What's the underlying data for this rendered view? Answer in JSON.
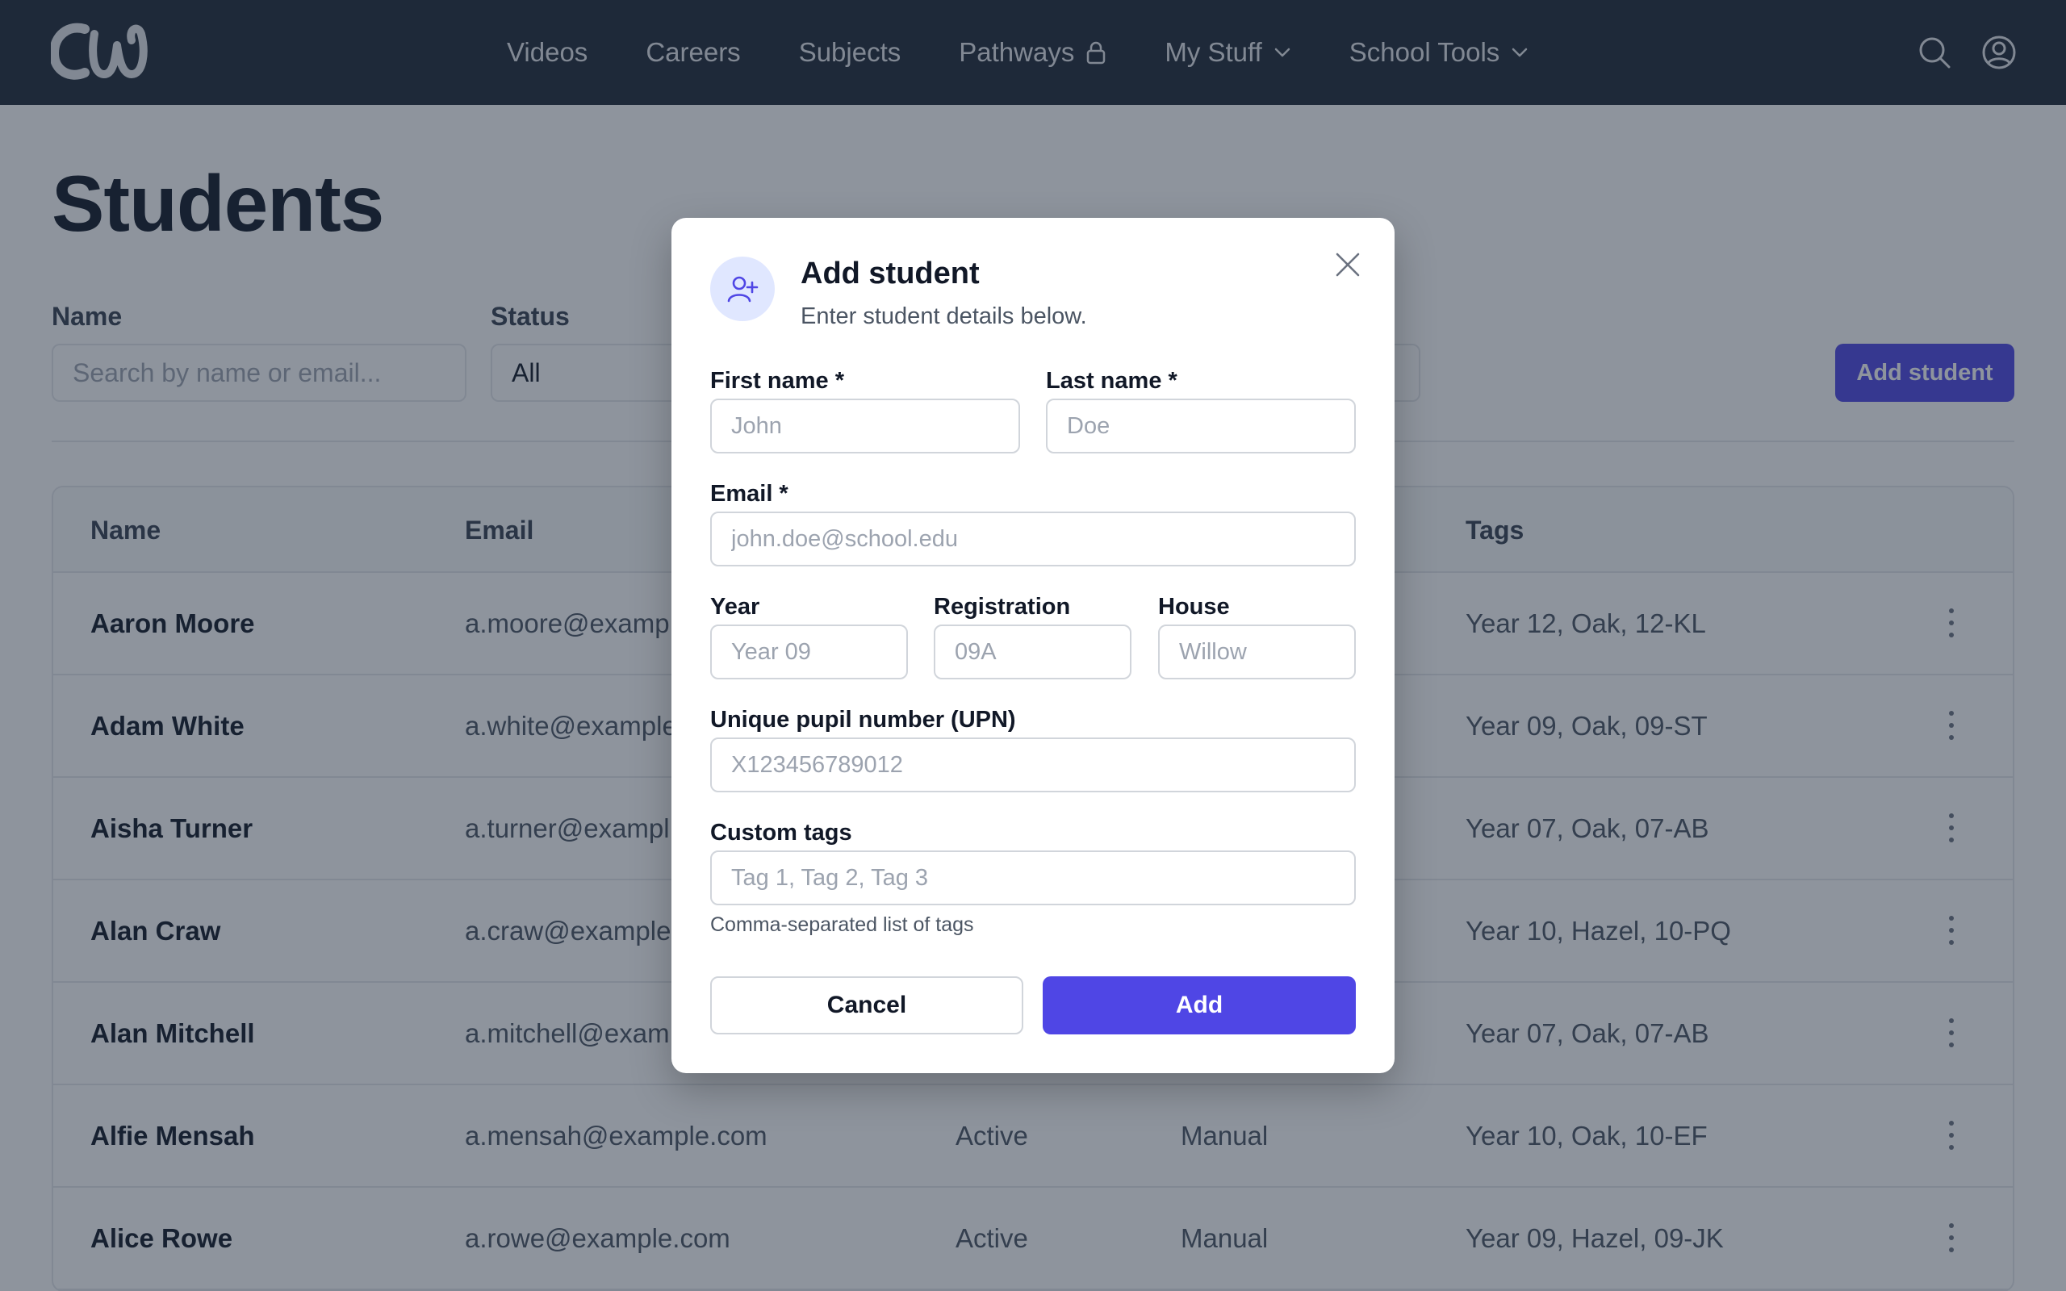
{
  "nav": {
    "links": [
      {
        "label": "Videos"
      },
      {
        "label": "Careers"
      },
      {
        "label": "Subjects"
      },
      {
        "label": "Pathways",
        "icon": "lock-icon"
      },
      {
        "label": "My Stuff",
        "icon": "chevron-down-icon"
      },
      {
        "label": "School Tools",
        "icon": "chevron-down-icon"
      }
    ],
    "icons": [
      "search-icon",
      "user-circle-icon"
    ]
  },
  "page": {
    "title": "Students",
    "filters": {
      "name_label": "Name",
      "name_placeholder": "Search by name or email...",
      "status_label": "Status",
      "status_value": "All"
    },
    "add_student_label": "Add student"
  },
  "table": {
    "headers": [
      "Name",
      "Email",
      "Tags"
    ],
    "rows": [
      {
        "name": "Aaron Moore",
        "email": "a.moore@examp",
        "tags": "Year 12, Oak, 12-KL"
      },
      {
        "name": "Adam White",
        "email": "a.white@example",
        "tags": "Year 09, Oak, 09-ST"
      },
      {
        "name": "Aisha Turner",
        "email": "a.turner@exampl",
        "tags": "Year 07, Oak, 07-AB"
      },
      {
        "name": "Alan Craw",
        "email": "a.craw@example",
        "tags": "Year 10, Hazel, 10-PQ"
      },
      {
        "name": "Alan Mitchell",
        "email": "a.mitchell@exam",
        "tags": "Year 07, Oak, 07-AB"
      },
      {
        "name": "Alfie Mensah",
        "email": "a.mensah@example.com",
        "status": "Active",
        "source": "Manual",
        "tags": "Year 10, Oak, 10-EF"
      },
      {
        "name": "Alice Rowe",
        "email": "a.rowe@example.com",
        "status": "Active",
        "source": "Manual",
        "tags": "Year 09, Hazel, 09-JK"
      }
    ]
  },
  "modal": {
    "title": "Add student",
    "subtitle": "Enter student details below.",
    "first_name": {
      "label": "First name *",
      "placeholder": "John"
    },
    "last_name": {
      "label": "Last name *",
      "placeholder": "Doe"
    },
    "email": {
      "label": "Email *",
      "placeholder": "john.doe@school.edu"
    },
    "year": {
      "label": "Year",
      "placeholder": "Year 09"
    },
    "registration": {
      "label": "Registration",
      "placeholder": "09A"
    },
    "house": {
      "label": "House",
      "placeholder": "Willow"
    },
    "upn": {
      "label": "Unique pupil number (UPN)",
      "placeholder": "X123456789012"
    },
    "tags": {
      "label": "Custom tags",
      "placeholder": "Tag 1, Tag 2, Tag 3",
      "help": "Comma-separated list of tags"
    },
    "cancel_label": "Cancel",
    "add_label": "Add"
  },
  "colors": {
    "navbar": "#1f2937",
    "accent": "#4f46e5",
    "overlay": "rgba(30,41,59,0.5)"
  }
}
